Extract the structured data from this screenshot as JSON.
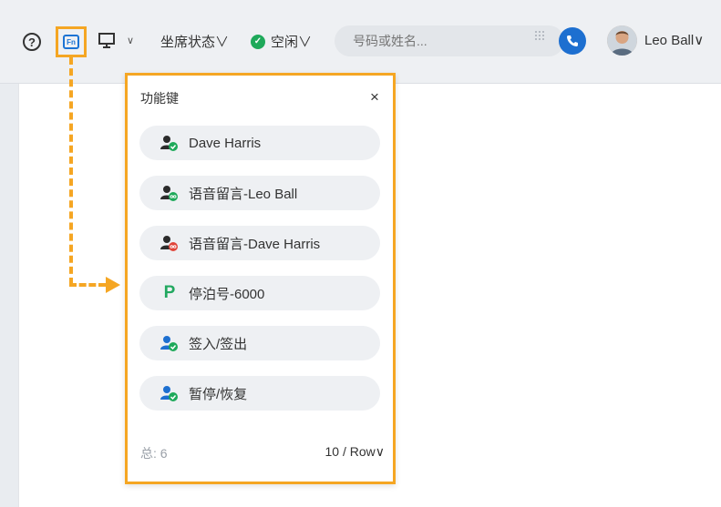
{
  "toolbar": {
    "help_glyph": "?",
    "fn_label": "Fn",
    "monitor_caret": "∨",
    "seat_status_label": "坐席状态∨",
    "presence_label": "空闲∨",
    "search_placeholder": "号码或姓名...",
    "user_name": "Leo Ball∨"
  },
  "panel": {
    "title": "功能键",
    "close": "×",
    "items": [
      {
        "label": "Dave Harris",
        "icon": "contact-available-icon",
        "badge_color": "#1ea95a"
      },
      {
        "label": "语音留言-Leo Ball",
        "icon": "voicemail-contact-icon",
        "badge_color": "#1ea95a"
      },
      {
        "label": "语音留言-Dave Harris",
        "icon": "voicemail-contact-icon",
        "badge_color": "#e0453a"
      },
      {
        "label": "停泊号-6000",
        "icon": "park-icon",
        "badge_color": "#22a860"
      },
      {
        "label": "签入/签出",
        "icon": "queue-login-icon",
        "badge_color": "#1ea95a"
      },
      {
        "label": "暂停/恢复",
        "icon": "queue-pause-icon",
        "badge_color": "#1ea95a"
      }
    ],
    "total": "总: 6",
    "per_page": "10 / Row∨"
  },
  "colors": {
    "accent_highlight": "#f5a623",
    "primary_blue": "#1d6fd0",
    "available_green": "#1ea95a",
    "busy_red": "#e0453a"
  }
}
